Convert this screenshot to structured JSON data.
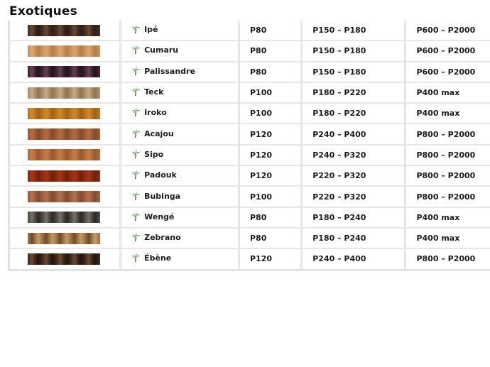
{
  "section_title": "Exotiques",
  "icon": "palm-tree-icon",
  "rows": [
    {
      "name": "Ipé",
      "grit_start": "P80",
      "grit_mid": "P150 – P180",
      "grit_finish": "P600 – P2000",
      "colors": [
        "#3f2a1f",
        "#6a4a35",
        "#2e1e15"
      ]
    },
    {
      "name": "Cumaru",
      "grit_start": "P80",
      "grit_mid": "P150 – P180",
      "grit_finish": "P600 – P2000",
      "colors": [
        "#c88f5a",
        "#dba772",
        "#b57c48"
      ]
    },
    {
      "name": "Palissandre",
      "grit_start": "P80",
      "grit_mid": "P150 – P180",
      "grit_finish": "P600 – P2000",
      "colors": [
        "#3a2230",
        "#6a4152",
        "#22131c"
      ]
    },
    {
      "name": "Teck",
      "grit_start": "P100",
      "grit_mid": "P180 – P220",
      "grit_finish": "P400 max",
      "colors": [
        "#a88a63",
        "#c8ad86",
        "#8e7453"
      ]
    },
    {
      "name": "Iroko",
      "grit_start": "P100",
      "grit_mid": "P180 – P220",
      "grit_finish": "P400 max",
      "colors": [
        "#b8741e",
        "#d08a2e",
        "#9e6116"
      ]
    },
    {
      "name": "Acajou",
      "grit_start": "P120",
      "grit_mid": "P240 – P400",
      "grit_finish": "P800 – P2000",
      "colors": [
        "#9c5a32",
        "#b66d40",
        "#844a28"
      ]
    },
    {
      "name": "Sipo",
      "grit_start": "P120",
      "grit_mid": "P240 – P320",
      "grit_finish": "P800 – P2000",
      "colors": [
        "#b06a35",
        "#c97c44",
        "#94582b"
      ]
    },
    {
      "name": "Padouk",
      "grit_start": "P120",
      "grit_mid": "P220 – P320",
      "grit_finish": "P800 – P2000",
      "colors": [
        "#8a2a10",
        "#a83518",
        "#6e200b"
      ]
    },
    {
      "name": "Bubinga",
      "grit_start": "P100",
      "grit_mid": "P220 – P320",
      "grit_finish": "P800 – P2000",
      "colors": [
        "#9a5d3d",
        "#b4714e",
        "#7f4b30"
      ]
    },
    {
      "name": "Wengé",
      "grit_start": "P80",
      "grit_mid": "P180 – P240",
      "grit_finish": "P400 max",
      "colors": [
        "#4a4540",
        "#7a7065",
        "#2c2824"
      ]
    },
    {
      "name": "Zebrano",
      "grit_start": "P80",
      "grit_mid": "P180 – P240",
      "grit_finish": "P400 max",
      "colors": [
        "#a57a48",
        "#6e4a28",
        "#c49a62"
      ]
    },
    {
      "name": "Ébène",
      "grit_start": "P120",
      "grit_mid": "P240 – P400",
      "grit_finish": "P800 – P2000",
      "colors": [
        "#3a2518",
        "#6b4a32",
        "#22150d"
      ]
    }
  ]
}
